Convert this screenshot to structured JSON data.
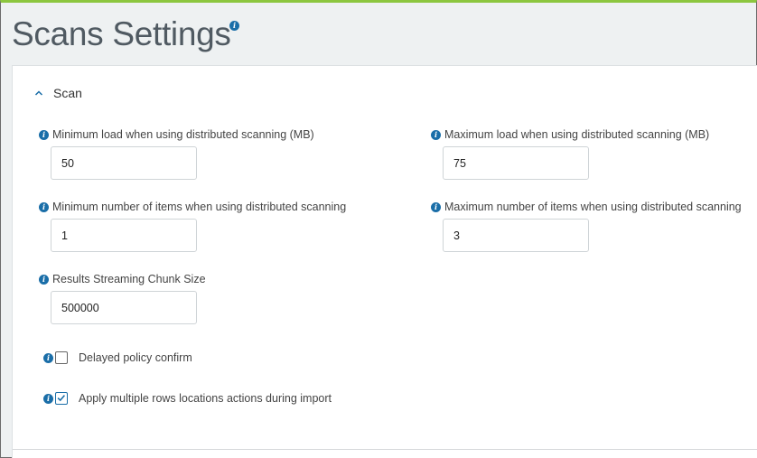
{
  "page": {
    "title": "Scans Settings",
    "title_info_icon": "info-icon"
  },
  "section": {
    "label": "Scan",
    "expanded": true,
    "toggle_icon": "chevron-up-icon"
  },
  "fields": {
    "min_load": {
      "label": "Minimum load when using distributed scanning (MB)",
      "value": "50"
    },
    "max_load": {
      "label": "Maximum load when using distributed scanning (MB)",
      "value": "75"
    },
    "min_items": {
      "label": "Minimum number of items when using distributed scanning",
      "value": "1"
    },
    "max_items": {
      "label": "Maximum number of items when using distributed scanning",
      "value": "3"
    },
    "chunk_size": {
      "label": "Results Streaming Chunk Size",
      "value": "500000"
    }
  },
  "checkboxes": {
    "delayed_policy": {
      "label": "Delayed policy confirm",
      "checked": false
    },
    "multi_rows": {
      "label": "Apply multiple rows locations actions during import",
      "checked": true
    }
  },
  "colors": {
    "accent": "#1a6ea8",
    "top_bar": "#8cc63f",
    "title_text": "#505a62",
    "page_bg": "#eef1f2"
  }
}
